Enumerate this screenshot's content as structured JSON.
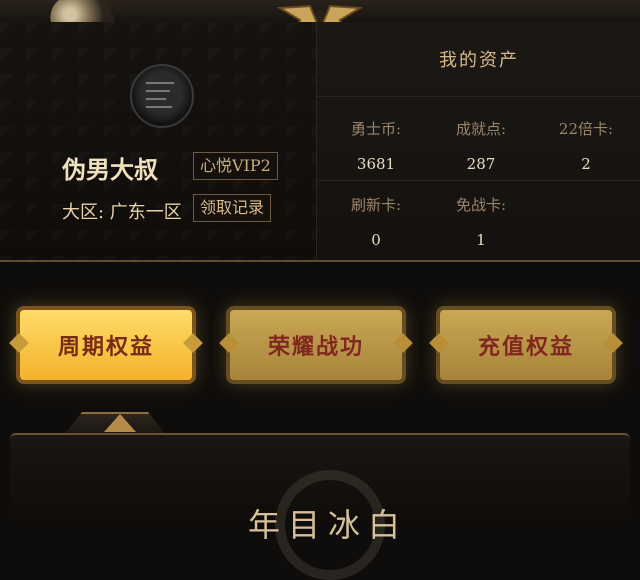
{
  "assets": {
    "title": "我的资产",
    "items": [
      {
        "label": "勇士币:",
        "value": "3681"
      },
      {
        "label": "成就点:",
        "value": "287"
      },
      {
        "label": "22倍卡:",
        "value": "2"
      },
      {
        "label": "刷新卡:",
        "value": "0"
      },
      {
        "label": "免战卡:",
        "value": "1"
      }
    ]
  },
  "profile": {
    "name": "伪男大叔",
    "vip": "心悦VIP2",
    "region": "大区: 广东一区",
    "record_link": "领取记录"
  },
  "tabs": [
    {
      "label": "周期权益",
      "state": "active"
    },
    {
      "label": "荣耀战功",
      "state": "inactive"
    },
    {
      "label": "充值权益",
      "state": "inactive"
    }
  ],
  "section": {
    "title": "年目冰白"
  }
}
